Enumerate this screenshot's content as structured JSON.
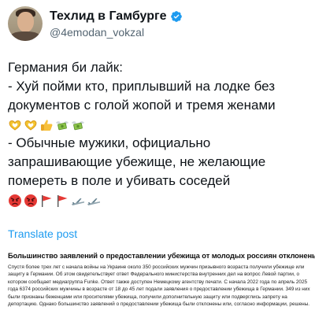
{
  "profile": {
    "display_name": "Техлид в Гамбурге",
    "handle": "@4emodan_vokzal"
  },
  "tweet": {
    "line1": "Германия би лайк:",
    "line2": "- Хуй пойми кто, приплывший на лодке без документов с голой жопой и тремя женами",
    "line3": "- Обычные мужики, официально запрашивающие убежище, не желающие померeть в поле и убивать соседей"
  },
  "translate_label": "Translate post",
  "news": {
    "title": "Большинство заявлений о предоставлении убежища от молодых россиян отклонены",
    "body": "Спустя более трех лет с начала войны на Украине около 350 российских мужчин призывного возраста получили убежище или защиту в Германии. Об этом свидетельствует ответ Федерального министерства внутренних дел на вопрос Левой партии, о котором сообщает медиагруппа Funke. Ответ также доступен Немецкому агентству печати. С начала 2022 года по апрель 2025 года 6374 российских мужчины в возрасте от 18 до 45 лет подали заявления о предоставлении убежища в Германии. 349 из них были признаны беженцами или просителями убежища, получили дополнительную защиту или подверглись запрету на депортацию. Однако большинство заявлений о предоставлении убежища были отклонены или, согласно информации, решены."
  },
  "icons": {
    "verified": "verified-badge-icon",
    "emoji_set_1": [
      "heart-hands-emoji",
      "heart-hands-emoji",
      "thumbs-up-emoji",
      "money-wings-emoji",
      "money-wings-emoji"
    ],
    "emoji_set_2": [
      "angry-face-emoji",
      "angry-face-emoji",
      "red-flag-emoji",
      "red-flag-emoji",
      "airplane-emoji",
      "airplane-emoji"
    ]
  },
  "colors": {
    "text": "#0f1419",
    "secondary": "#536471",
    "link": "#1d9bf0",
    "verified": "#1d9bf0"
  }
}
